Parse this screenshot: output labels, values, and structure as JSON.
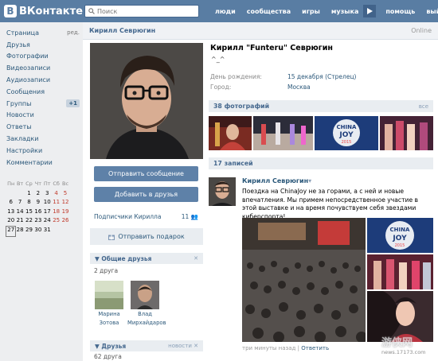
{
  "header": {
    "logo": "ВКонтакте",
    "search_placeholder": "Поиск",
    "nav": [
      "люди",
      "сообщества",
      "игры",
      "музыка",
      "помощь",
      "выйти"
    ]
  },
  "sidebar": {
    "items": [
      {
        "label": "Страница",
        "extra": "ред."
      },
      {
        "label": "Друзья"
      },
      {
        "label": "Фотографии"
      },
      {
        "label": "Видеозаписи"
      },
      {
        "label": "Аудиозаписи"
      },
      {
        "label": "Сообщения"
      },
      {
        "label": "Группы",
        "badge": "+1"
      },
      {
        "label": "Новости"
      },
      {
        "label": "Ответы"
      },
      {
        "label": "Закладки"
      },
      {
        "label": "Настройки"
      },
      {
        "label": "Комментарии"
      }
    ]
  },
  "calendar": {
    "days": [
      "Пн",
      "Вт",
      "Ср",
      "Чт",
      "Пт",
      "Сб",
      "Вс"
    ],
    "weeks": [
      [
        "",
        "",
        "1",
        "2",
        "3",
        "4",
        "5"
      ],
      [
        "6",
        "7",
        "8",
        "9",
        "10",
        "11",
        "12"
      ],
      [
        "13",
        "14",
        "15",
        "16",
        "17",
        "18",
        "19"
      ],
      [
        "20",
        "21",
        "22",
        "23",
        "24",
        "25",
        "26"
      ],
      [
        "27",
        "28",
        "29",
        "30",
        "31",
        "",
        ""
      ]
    ],
    "today": "27"
  },
  "profile": {
    "page_title": "Кирилл Севрюгин",
    "status": "Online",
    "full_name": "Кирилл \"Funteru\" Севрюгин",
    "emoticon": "^_^",
    "birthday_label": "День рождения:",
    "birthday_value": "15 декабря (Стрелец)",
    "city_label": "Город:",
    "city_value": "Москва",
    "send_message": "Отправить сообщение",
    "add_friend": "Добавить в друзья",
    "subscribers_label": "Подписчики Кирилла",
    "subscribers_count": "11",
    "gift": "Отправить подарок",
    "mutual_title": "Общие друзья",
    "mutual_count": "2 друга",
    "mutual_friends": [
      {
        "first": "Марина",
        "last": "Зотова"
      },
      {
        "first": "Влад",
        "last": "Мирхайдаров"
      }
    ],
    "friends_title": "Друзья",
    "friends_extra": "новости",
    "friends_count": "62 друга"
  },
  "photos": {
    "title": "38 фотографий",
    "all": "все"
  },
  "wall": {
    "title": "17 записей",
    "author": "Кирилл Севрюгин",
    "text": "Поездка на ChinaJoy не за горами, а с ней и новые впечатления. Мы примем непосредственное участие в этой выставке и на время почувствуем себя звездами киберспорта!",
    "time": "три минуты назад",
    "sep": "|",
    "reply": "Ответить"
  },
  "watermark": {
    "big": "游侠网",
    "small": "news.17173.com"
  },
  "colors": {
    "header": "#597da3",
    "accent": "#5e81a8",
    "link": "#2b587a"
  }
}
